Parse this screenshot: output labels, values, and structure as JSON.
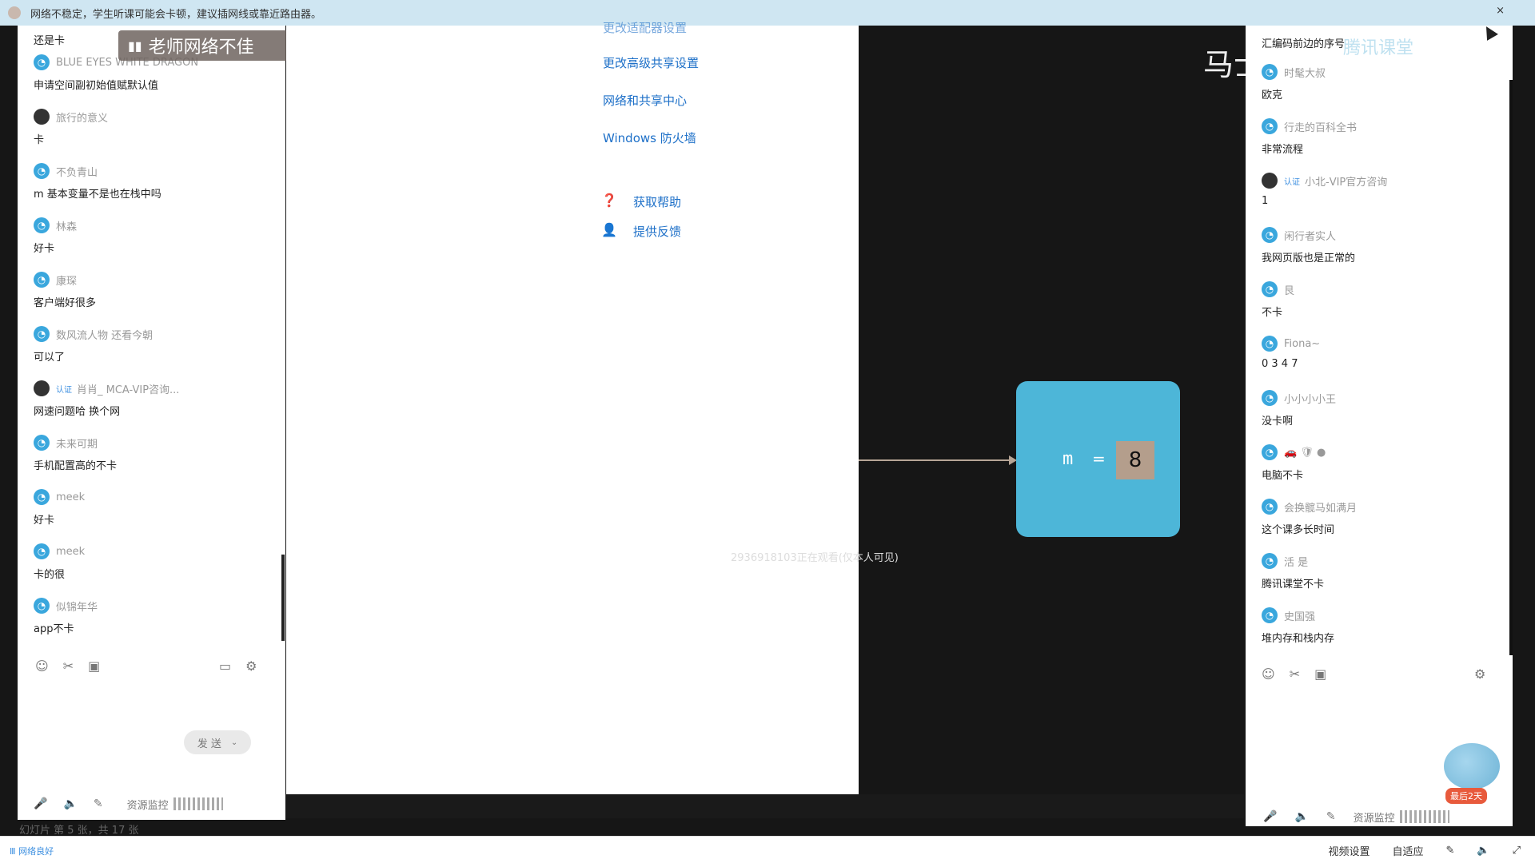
{
  "banner": {
    "text": "网络不稳定，学生听课可能会卡顿，建议插网线或靠近路由器。",
    "close": "×"
  },
  "teacher_badge": {
    "text": "老师网络不佳",
    "icon": "signal-bars-icon"
  },
  "left_chat": {
    "cut_top_msg": "还是卡",
    "items": [
      {
        "name": "BLUE EYES WHITE DRAGON",
        "msg": "申请空间副初始值赋默认值",
        "avatar": "qq"
      },
      {
        "name": "旅行的意义",
        "msg": "卡",
        "avatar": "photo"
      },
      {
        "name": "不负青山",
        "msg": "m 基本变量不是也在栈中吗",
        "avatar": "qq"
      },
      {
        "name": "林森",
        "msg": "好卡",
        "avatar": "qq"
      },
      {
        "name": "康琛",
        "msg": "客户端好很多",
        "avatar": "qq"
      },
      {
        "name": "数风流人物 还看今朝",
        "msg": "可以了",
        "avatar": "qq"
      },
      {
        "name": "肖肖_ MCA-VIP咨询...",
        "msg": "网速问题哈 换个网",
        "avatar": "photo",
        "vip": "认证"
      },
      {
        "name": "未来可期",
        "msg": "手机配置高的不卡",
        "avatar": "qq"
      },
      {
        "name": "meek",
        "msg": "好卡",
        "avatar": "qq"
      },
      {
        "name": "meek",
        "msg": "卡的很",
        "avatar": "qq"
      },
      {
        "name": "似锦年华",
        "msg": "app不卡",
        "avatar": "qq"
      }
    ]
  },
  "left_toolbar": {
    "icons": [
      "emoji-icon",
      "scissors-icon",
      "image-icon"
    ],
    "right_icons": [
      "chat-icon",
      "settings-icon"
    ]
  },
  "send_button": {
    "label": "发 送",
    "caret": "⌄"
  },
  "left_bottom": {
    "resource_label": "资源监控"
  },
  "slide_counter": "幻灯片 第 5 张，共 17 张",
  "control_panel": {
    "cut_link": "更改适配器设置",
    "links": [
      "更改高级共享设置",
      "网络和共享中心",
      "Windows 防火墙"
    ],
    "help_links": [
      "获取帮助",
      "提供反馈"
    ]
  },
  "diagram": {
    "var": "m",
    "eq": "=",
    "value": "8",
    "watermark": "2936918103正在观看(仅本人可见)",
    "title": "马士"
  },
  "right_chat": {
    "cut_top_msg": "汇编码前边的序号",
    "logo": "腾讯课堂",
    "items": [
      {
        "name": "时髦大叔",
        "msg": "欧克",
        "avatar": "qq"
      },
      {
        "name": "行走的百科全书",
        "msg": "非常流程",
        "avatar": "qq"
      },
      {
        "name": "小北-VIP官方咨询",
        "msg": "1",
        "avatar": "photo",
        "vip": "认证"
      },
      {
        "name": "闲行者实人",
        "msg": "我网页版也是正常的",
        "avatar": "qq"
      },
      {
        "name": "艮",
        "msg": "不卡",
        "avatar": "qq"
      },
      {
        "name": "Fiona~",
        "msg": "0 3 4 7",
        "avatar": "qq"
      },
      {
        "name": "小小小小王",
        "msg": "没卡啊",
        "avatar": "qq"
      },
      {
        "name": "🚗 🛡 ●",
        "msg": "电脑不卡",
        "avatar": "qq"
      },
      {
        "name": "会换髋马如满月",
        "msg": "这个课多长时间",
        "avatar": "qq"
      },
      {
        "name": "活 是",
        "msg": "腾讯课堂不卡",
        "avatar": "qq"
      },
      {
        "name": "史国强",
        "msg": "堆内存和栈内存",
        "avatar": "qq"
      }
    ]
  },
  "right_bottom": {
    "resource_label": "资源监控",
    "promo": "最后2天"
  },
  "status_bar": {
    "left": "Ⅲ 网络良好",
    "video_settings": "视频设置",
    "adapt": "自适应"
  }
}
